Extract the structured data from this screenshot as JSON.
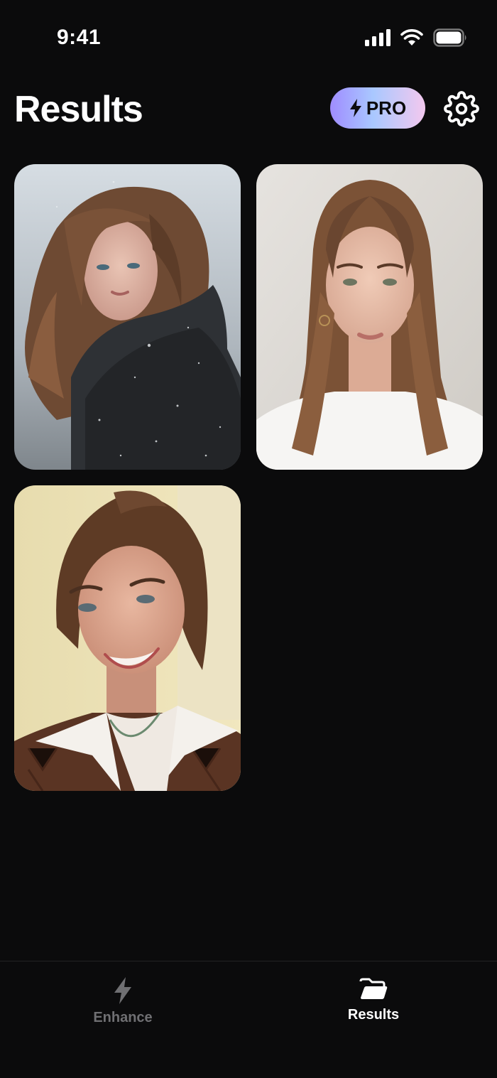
{
  "status_bar": {
    "time": "9:41",
    "icons": [
      "cellular-signal-icon",
      "wifi-icon",
      "battery-icon"
    ]
  },
  "header": {
    "title": "Results",
    "pro_label": "PRO",
    "settings_icon": "gear-icon"
  },
  "results": [
    {
      "description": "woman with long wind-blown brown hair and dark knit scarf in snow"
    },
    {
      "description": "woman with long straight brown hair and white t-shirt"
    },
    {
      "description": "smiling woman with hair up, white collar and brown sweater"
    }
  ],
  "tab_bar": {
    "tabs": [
      {
        "label": "Enhance",
        "icon": "lightning-icon",
        "active": false
      },
      {
        "label": "Results",
        "icon": "folder-icon",
        "active": true
      }
    ]
  },
  "colors": {
    "background": "#0b0b0c",
    "active_tab": "#ffffff",
    "inactive_tab": "#6f6f72"
  }
}
